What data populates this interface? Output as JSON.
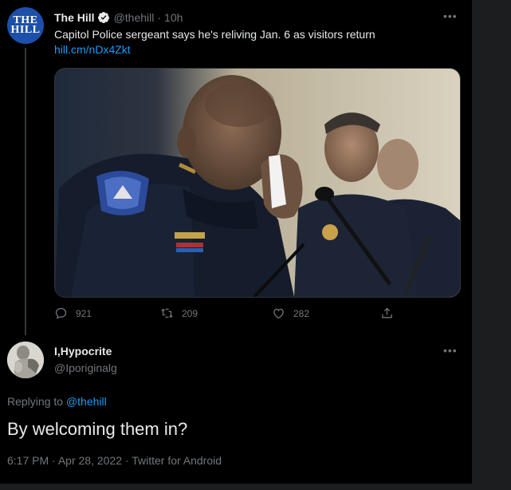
{
  "colors": {
    "background": "#000000",
    "text": "#e7e9ea",
    "muted": "#71767b",
    "link": "#1d9bf0",
    "hill_avatar": "#1d50a8"
  },
  "original_tweet": {
    "avatar_text_line1": "THE",
    "avatar_text_line2": "HILL",
    "display_name": "The Hill",
    "verified_icon": "verified-badge-icon",
    "handle": "@thehill",
    "separator": "·",
    "age": "10h",
    "more_icon_text": "•••",
    "text_before_link": "Capitol Police sergeant says he's reliving Jan. 6 as visitors return ",
    "link_text": "hill.cm/nDx4Zkt",
    "image_icon": "news-photo",
    "replies_count": "921",
    "retweets_count": "209",
    "likes_count": "282",
    "icons": [
      "reply-icon",
      "retweet-icon",
      "like-icon",
      "share-icon"
    ]
  },
  "reply_tweet": {
    "avatar_icon": "statue-avatar",
    "display_name": "I,Hypocrite",
    "handle": "@Iporiginalg",
    "more_icon_text": "•••",
    "replying_prefix": "Replying to ",
    "replying_handle": "@thehill",
    "text": "By welcoming them in?",
    "time": "6:17 PM",
    "date": "Apr 28, 2022",
    "separator": "·",
    "source": "Twitter for Android"
  }
}
